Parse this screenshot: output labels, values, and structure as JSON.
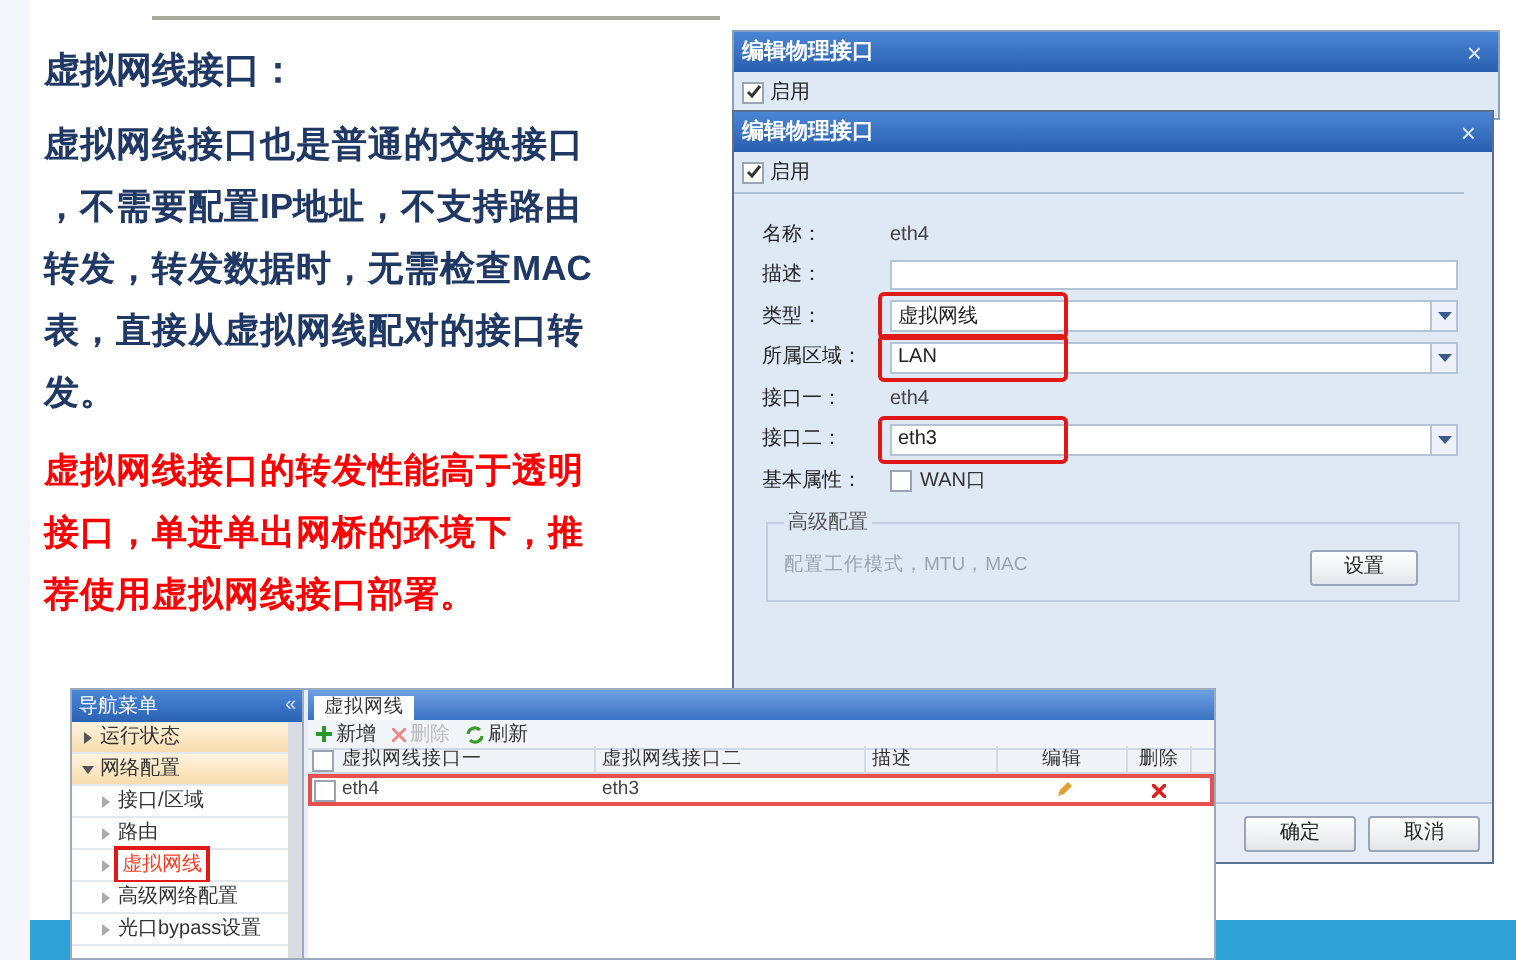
{
  "slide": {
    "heading": "虚拟网线接口：",
    "body": "虚拟网线接口也是普通的交换接口，不需要配置IP地址，不支持路由转发，转发数据时，无需检查MAC表，直接从虚拟网线配对的接口转发。",
    "note": "虚拟网线接口的转发性能高于透明接口，单进单出网桥的环境下，推荐使用虚拟网线接口部署。"
  },
  "back_dialog": {
    "title": "编辑物理接口",
    "close": "×",
    "enable": {
      "label": "启用",
      "checked": true
    }
  },
  "dialog": {
    "title": "编辑物理接口",
    "close": "×",
    "enable": {
      "label": "启用",
      "checked": true
    },
    "fields": [
      {
        "kind": "text",
        "label": "名称：",
        "value": "eth4"
      },
      {
        "kind": "input",
        "label": "描述："
      },
      {
        "kind": "select",
        "label": "类型：",
        "value": "虚拟网线",
        "highlighted": true
      },
      {
        "kind": "select",
        "label": "所属区域：",
        "value": "LAN",
        "highlighted": true
      },
      {
        "kind": "text",
        "label": "接口一：",
        "value": "eth4"
      },
      {
        "kind": "select",
        "label": "接口二：",
        "value": "eth3",
        "highlighted": true
      },
      {
        "kind": "checkbox",
        "label": "基本属性：",
        "option": "WAN口",
        "checked": false
      }
    ],
    "advanced": {
      "legend": "高级配置",
      "hint": "配置工作模式，MTU，MAC",
      "button": "设置"
    },
    "buttons": [
      "确定",
      "取消"
    ]
  },
  "nav": {
    "title": "导航菜单",
    "collapse": "«",
    "items": [
      {
        "label": "运行状态",
        "expanded": false
      },
      {
        "label": "网络配置",
        "expanded": true,
        "children": [
          {
            "label": "接口/区域",
            "selected": false
          },
          {
            "label": "路由",
            "selected": false
          },
          {
            "label": "虚拟网线",
            "selected": true
          },
          {
            "label": "高级网络配置",
            "selected": false
          },
          {
            "label": "光口bypass设置",
            "selected": false
          }
        ]
      }
    ]
  },
  "panel": {
    "tabs": [
      {
        "label": "虚拟网线",
        "selected": true
      }
    ],
    "toolbar": [
      {
        "kind": "add",
        "label": "新增",
        "disabled": false
      },
      {
        "kind": "delete",
        "label": "删除",
        "disabled": true
      },
      {
        "kind": "refresh",
        "label": "刷新",
        "disabled": false
      }
    ],
    "table": {
      "select_all_checked": false,
      "columns": [
        "虚拟网线接口一",
        "虚拟网线接口二",
        "描述",
        "编辑",
        "删除"
      ],
      "rows": [
        {
          "checked": false,
          "highlighted": true,
          "cells": [
            "eth4",
            "eth3"
          ]
        }
      ]
    }
  }
}
